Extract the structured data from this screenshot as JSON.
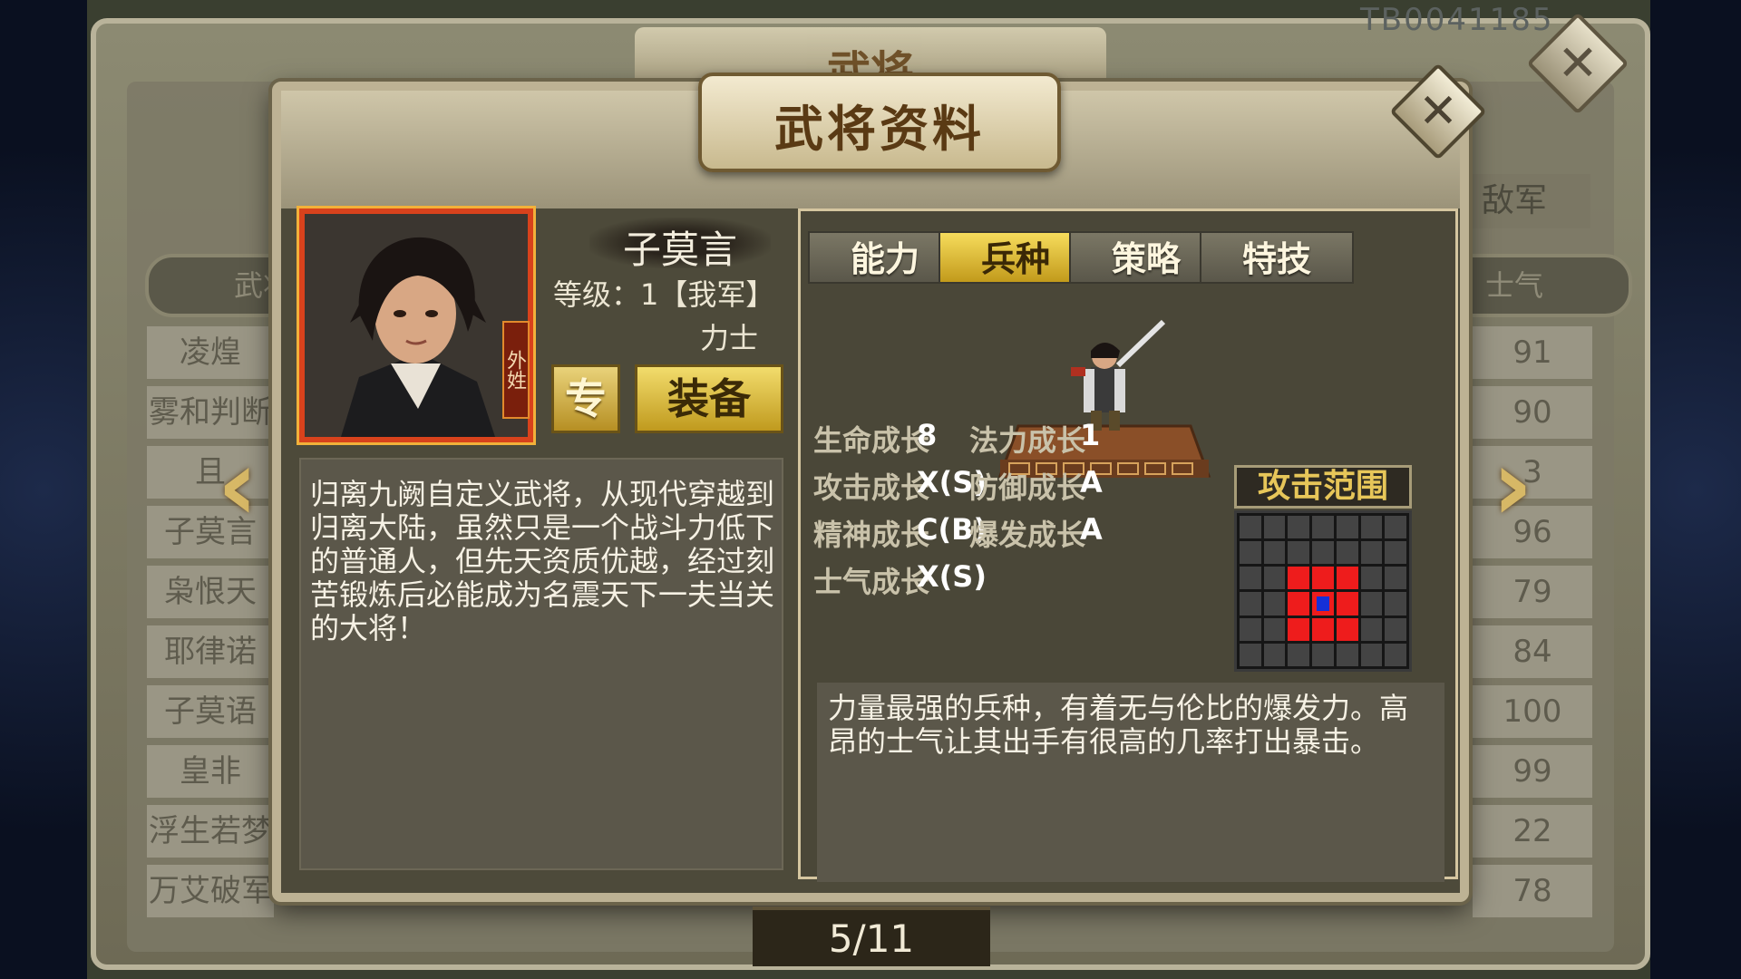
{
  "background": {
    "title": "武将",
    "code": "TB0041185",
    "header_left": "武将",
    "header_right": "士气",
    "army_label": "敌军",
    "left_names": [
      "凌煌",
      "雾和判断",
      "且",
      "子莫言",
      "枭恨天",
      "耶律诺",
      "子莫语",
      "皇非",
      "浮生若梦",
      "万艾破军"
    ],
    "right_values": [
      "91",
      "90",
      "3",
      "96",
      "79",
      "84",
      "100",
      "99",
      "22",
      "78"
    ]
  },
  "nav": {
    "prev": "‹",
    "next": "›"
  },
  "dialog": {
    "title": "武将资料",
    "close_glyph": "✕",
    "general": {
      "name": "子莫言",
      "level_label": "等级：",
      "level_value": "1【我军】",
      "unit_class": "力士",
      "portrait_tag": "外姓",
      "exclusive_button": "专",
      "equip_button": "装备",
      "bio": "归离九阙自定义武将，从现代穿越到归离大陆，虽然只是一个战斗力低下的普通人，但先天资质优越，经过刻苦锻炼后必能成为名震天下一夫当关的大将！"
    },
    "tabs": [
      {
        "label": "能力",
        "active": false
      },
      {
        "label": "兵种",
        "active": true
      },
      {
        "label": "策略",
        "active": false
      },
      {
        "label": "特技",
        "active": false
      }
    ],
    "growth": [
      {
        "label": "生命成长",
        "value": "8"
      },
      {
        "label": "法力成长",
        "value": "1"
      },
      {
        "label": "攻击成长",
        "value": "X(S)"
      },
      {
        "label": "防御成长",
        "value": "A"
      },
      {
        "label": "精神成长",
        "value": "C(B)"
      },
      {
        "label": "爆发成长",
        "value": "A"
      },
      {
        "label": "士气成长",
        "value": "X(S)"
      }
    ],
    "attack_range": {
      "title": "攻击范围",
      "colors": {
        "empty": "#444444",
        "range": "#ee1c1c",
        "self": "#1530d8"
      }
    },
    "unit_description": "力量最强的兵种，有着无与伦比的爆发力。高昂的士气让其出手有很高的几率打出暴击。"
  },
  "pager": "5/11"
}
